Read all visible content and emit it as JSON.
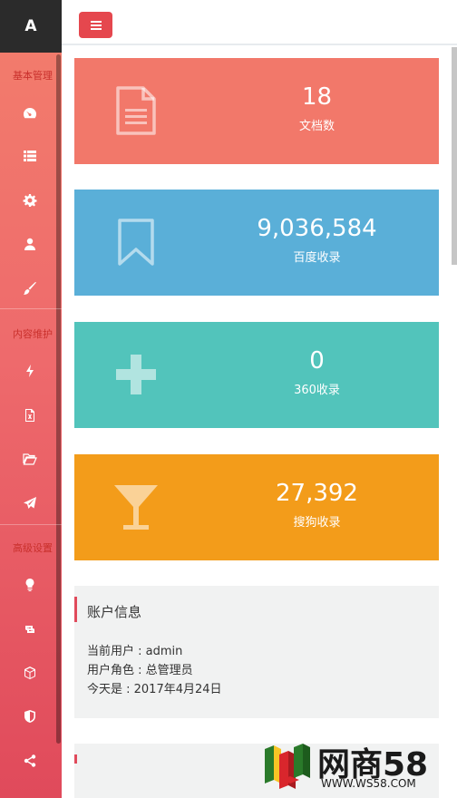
{
  "brand": {
    "letter": "A"
  },
  "sidebar": {
    "sections": [
      {
        "title": "基本管理"
      },
      {
        "title": "内容维护"
      },
      {
        "title": "高级设置"
      }
    ],
    "icons": [
      "dashboard-icon",
      "list-icon",
      "gear-icon",
      "user-icon",
      "brush-icon",
      "bolt-icon",
      "excel-file-icon",
      "folder-open-icon",
      "paper-plane-icon",
      "lightbulb-icon",
      "retweet-icon",
      "cube-icon",
      "shield-icon",
      "share-icon"
    ]
  },
  "cards": [
    {
      "value": "18",
      "label": "文档数",
      "color": "#f2786a",
      "icon": "document-icon"
    },
    {
      "value": "9,036,584",
      "label": "百度收录",
      "color": "#5aafd8",
      "icon": "bookmark-icon"
    },
    {
      "value": "0",
      "label": "360收录",
      "color": "#52c4bb",
      "icon": "plus-icon"
    },
    {
      "value": "27,392",
      "label": "搜狗收录",
      "color": "#f39c1a",
      "icon": "cocktail-glass-icon"
    }
  ],
  "account": {
    "title": "账户信息",
    "current_user": "当前用户 : admin",
    "user_role": "用户角色 : 总管理员",
    "today": "今天是 : 2017年4月24日"
  },
  "watermark": {
    "name": "网商58",
    "url": "WWW.WS58.COM"
  },
  "colors": {
    "accent": "#e5474e",
    "sidebar_top": "#f37e6c",
    "sidebar_bottom": "#e04a5b"
  }
}
